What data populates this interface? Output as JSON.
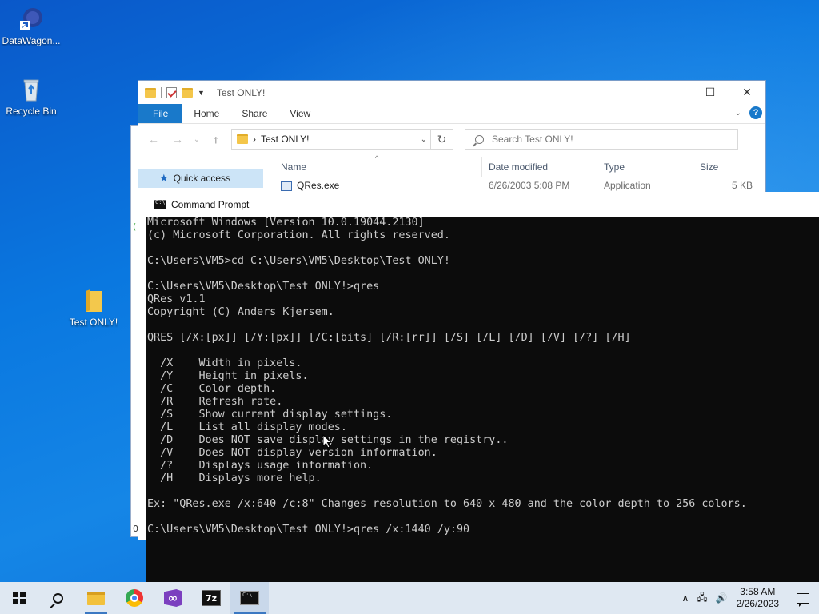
{
  "desktop": {
    "icons": [
      {
        "label": "DataWagon...",
        "icon": "shortcut-icon"
      },
      {
        "label": "Recycle Bin",
        "icon": "recycle-bin-icon"
      },
      {
        "label": "Test ONLY!",
        "icon": "folder-icon"
      }
    ]
  },
  "explorer": {
    "title": "Test ONLY!",
    "controls": {
      "minimize": "—",
      "maximize": "☐",
      "close": "✕"
    },
    "ribbon_tabs": [
      "File",
      "Home",
      "Share",
      "View"
    ],
    "nav": {
      "back": "←",
      "forward": "→",
      "recent": "⌄",
      "up": "↑"
    },
    "address": {
      "separator": "›",
      "path": "Test ONLY!",
      "dropdown": "⌄",
      "refresh": "↻"
    },
    "search": {
      "placeholder": "Search Test ONLY!"
    },
    "nav_pane": {
      "quick_access": "Quick access"
    },
    "columns": [
      "Name",
      "Date modified",
      "Type",
      "Size"
    ],
    "rows": [
      {
        "name": "QRes.exe",
        "date": "6/26/2003 5:08 PM",
        "type": "Application",
        "size": "5 KB"
      }
    ],
    "left_fragment": {
      "top_glyph": "(",
      "bottom_glyph": "0"
    }
  },
  "cmd": {
    "title": "Command Prompt",
    "lines": [
      "Microsoft Windows [Version 10.0.19044.2130]",
      "(c) Microsoft Corporation. All rights reserved.",
      "",
      "C:\\Users\\VM5>cd C:\\Users\\VM5\\Desktop\\Test ONLY!",
      "",
      "C:\\Users\\VM5\\Desktop\\Test ONLY!>qres",
      "QRes v1.1",
      "Copyright (C) Anders Kjersem.",
      "",
      "QRES [/X:[px]] [/Y:[px]] [/C:[bits] [/R:[rr]] [/S] [/L] [/D] [/V] [/?] [/H]",
      "",
      "  /X    Width in pixels.",
      "  /Y    Height in pixels.",
      "  /C    Color depth.",
      "  /R    Refresh rate.",
      "  /S    Show current display settings.",
      "  /L    List all display modes.",
      "  /D    Does NOT save display settings in the registry..",
      "  /V    Does NOT display version information.",
      "  /?    Displays usage information.",
      "  /H    Displays more help.",
      "",
      "Ex: \"QRes.exe /x:640 /c:8\" Changes resolution to 640 x 480 and the color depth to 256 colors.",
      "",
      "C:\\Users\\VM5\\Desktop\\Test ONLY!>qres /x:1440 /y:90"
    ]
  },
  "taskbar": {
    "apps": [
      {
        "name": "start",
        "icon": "windows-start-icon"
      },
      {
        "name": "search",
        "icon": "search-icon"
      },
      {
        "name": "file-explorer",
        "icon": "file-explorer-icon"
      },
      {
        "name": "chrome",
        "icon": "chrome-icon"
      },
      {
        "name": "visual-studio",
        "icon": "visual-studio-icon"
      },
      {
        "name": "7zip",
        "icon": "7zip-icon",
        "text": "7z"
      },
      {
        "name": "command-prompt",
        "icon": "command-prompt-icon"
      }
    ],
    "tray": {
      "chevron": "∧",
      "network": "🖧",
      "volume": "🔊"
    },
    "clock": {
      "time": "3:58 AM",
      "date": "2/26/2023"
    }
  }
}
